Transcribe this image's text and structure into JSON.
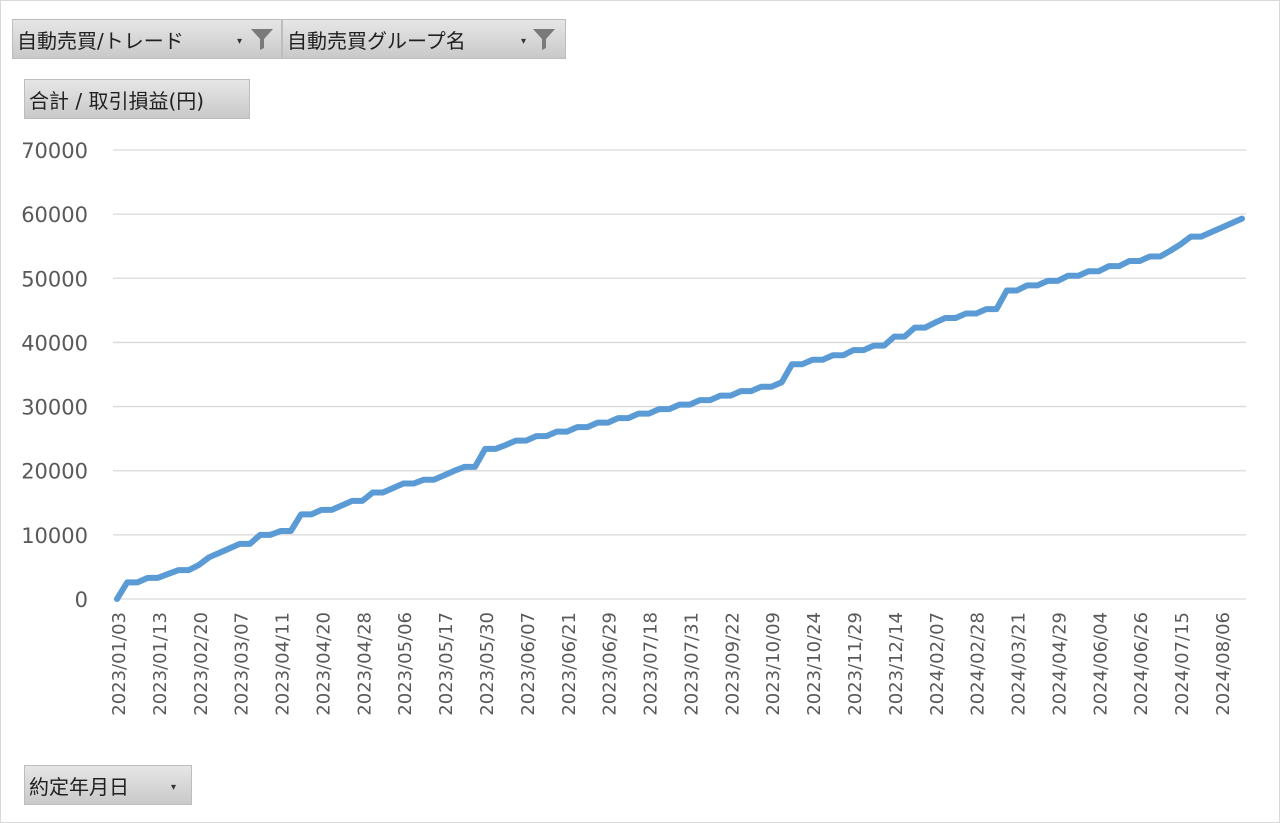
{
  "filters": {
    "trade_filter_label": "自動売買/トレード",
    "group_filter_label": "自動売買グループ名",
    "value_field_label": "合計 / 取引損益(円)",
    "axis_field_label": "約定年月日",
    "dropdown_glyph": "▾",
    "filter_icon": "funnel-icon"
  },
  "chart_data": {
    "type": "line",
    "title": "",
    "xlabel": "",
    "ylabel": "",
    "ylim": [
      0,
      70000
    ],
    "yticks": [
      0,
      10000,
      20000,
      30000,
      40000,
      50000,
      60000,
      70000
    ],
    "grid": true,
    "legend": "none",
    "line_color": "#5B9BD5",
    "x_tick_labels": [
      "2023/01/03",
      "2023/01/13",
      "2023/02/20",
      "2023/03/07",
      "2023/04/11",
      "2023/04/20",
      "2023/04/28",
      "2023/05/06",
      "2023/05/17",
      "2023/05/30",
      "2023/06/07",
      "2023/06/21",
      "2023/06/29",
      "2023/07/18",
      "2023/07/31",
      "2023/09/22",
      "2023/10/09",
      "2023/10/24",
      "2023/11/29",
      "2023/12/14",
      "2024/02/07",
      "2024/02/28",
      "2024/03/21",
      "2024/04/29",
      "2024/06/04",
      "2024/06/26",
      "2024/07/15",
      "2024/08/06"
    ],
    "series": [
      {
        "values": [
          0,
          2600,
          2600,
          3300,
          3300,
          3900,
          4500,
          4500,
          5300,
          6500,
          7200,
          7900,
          8600,
          8600,
          10000,
          10000,
          10600,
          10600,
          13200,
          13200,
          13900,
          13900,
          14600,
          15300,
          15300,
          16600,
          16600,
          17300,
          18000,
          18000,
          18600,
          18600,
          19300,
          20000,
          20600,
          20600,
          23400,
          23400,
          24000,
          24700,
          24700,
          25400,
          25400,
          26100,
          26100,
          26800,
          26800,
          27500,
          27500,
          28200,
          28200,
          28900,
          28900,
          29600,
          29600,
          30300,
          30300,
          31000,
          31000,
          31700,
          31700,
          32400,
          32400,
          33100,
          33100,
          33800,
          36600,
          36600,
          37300,
          37300,
          38000,
          38000,
          38800,
          38800,
          39500,
          39500,
          40900,
          40900,
          42300,
          42300,
          43100,
          43800,
          43800,
          44500,
          44500,
          45200,
          45200,
          48100,
          48100,
          48900,
          48900,
          49600,
          49600,
          50400,
          50400,
          51100,
          51100,
          51900,
          51900,
          52700,
          52700,
          53400,
          53400,
          54300,
          55300,
          56500,
          56500,
          57200,
          57900,
          58600,
          59300
        ]
      }
    ]
  }
}
